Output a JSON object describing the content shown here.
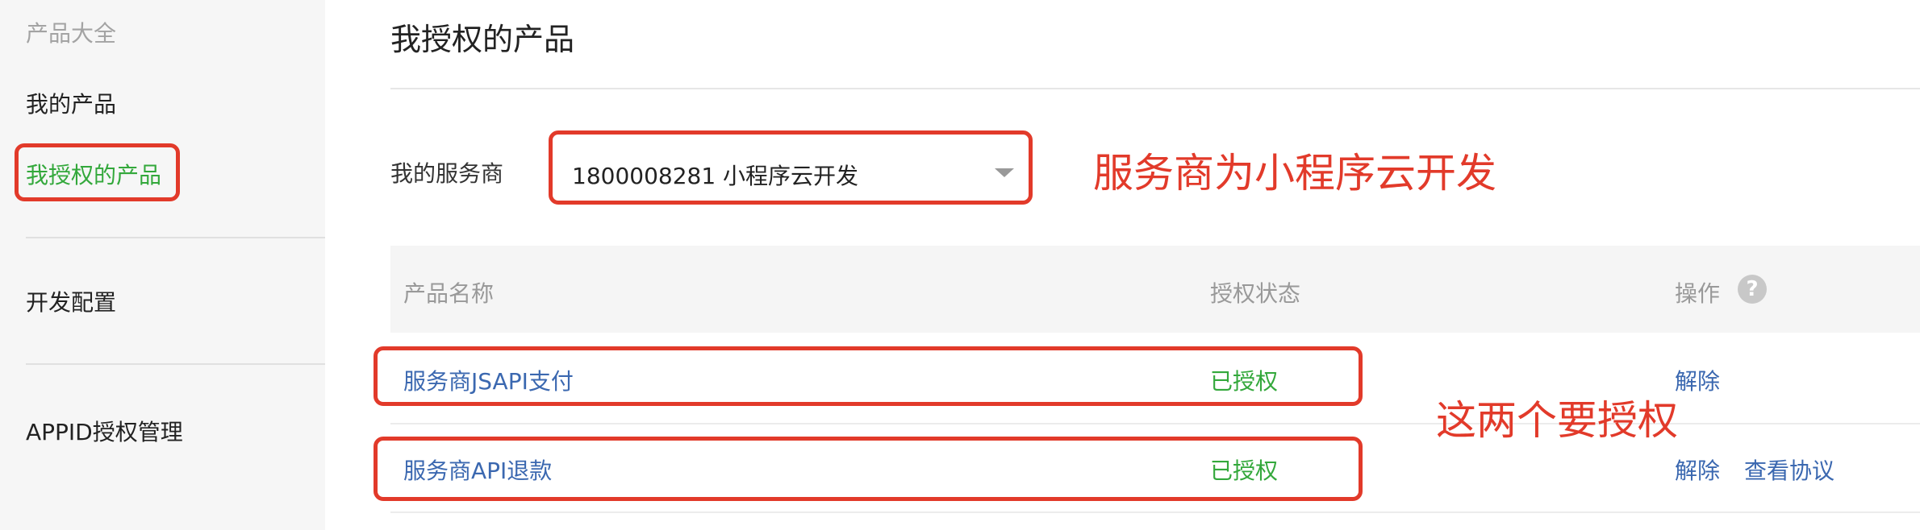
{
  "sidebar": {
    "heading": "产品大全",
    "items": [
      {
        "label": "我的产品"
      },
      {
        "label": "我授权的产品"
      },
      {
        "label": "开发配置"
      },
      {
        "label": "APPID授权管理"
      }
    ]
  },
  "main": {
    "title": "我授权的产品",
    "provider_label": "我的服务商",
    "provider_value": "1800008281 小程序云开发",
    "annotation_provider": "服务商为小程序云开发",
    "annotation_rows": "这两个要授权",
    "table": {
      "headers": [
        "产品名称",
        "授权状态",
        "操作"
      ],
      "rows": [
        {
          "name": "服务商JSAPI支付",
          "status": "已授权",
          "actions": [
            "解除"
          ]
        },
        {
          "name": "服务商API退款",
          "status": "已授权",
          "actions": [
            "解除",
            "查看协议"
          ]
        }
      ]
    }
  },
  "colors": {
    "accent_green": "#33a83b",
    "annotation_red": "#e23a2a",
    "link_blue": "#3b68b0"
  },
  "icons": {
    "help": "question-circle-icon"
  },
  "help_glyph": "?"
}
